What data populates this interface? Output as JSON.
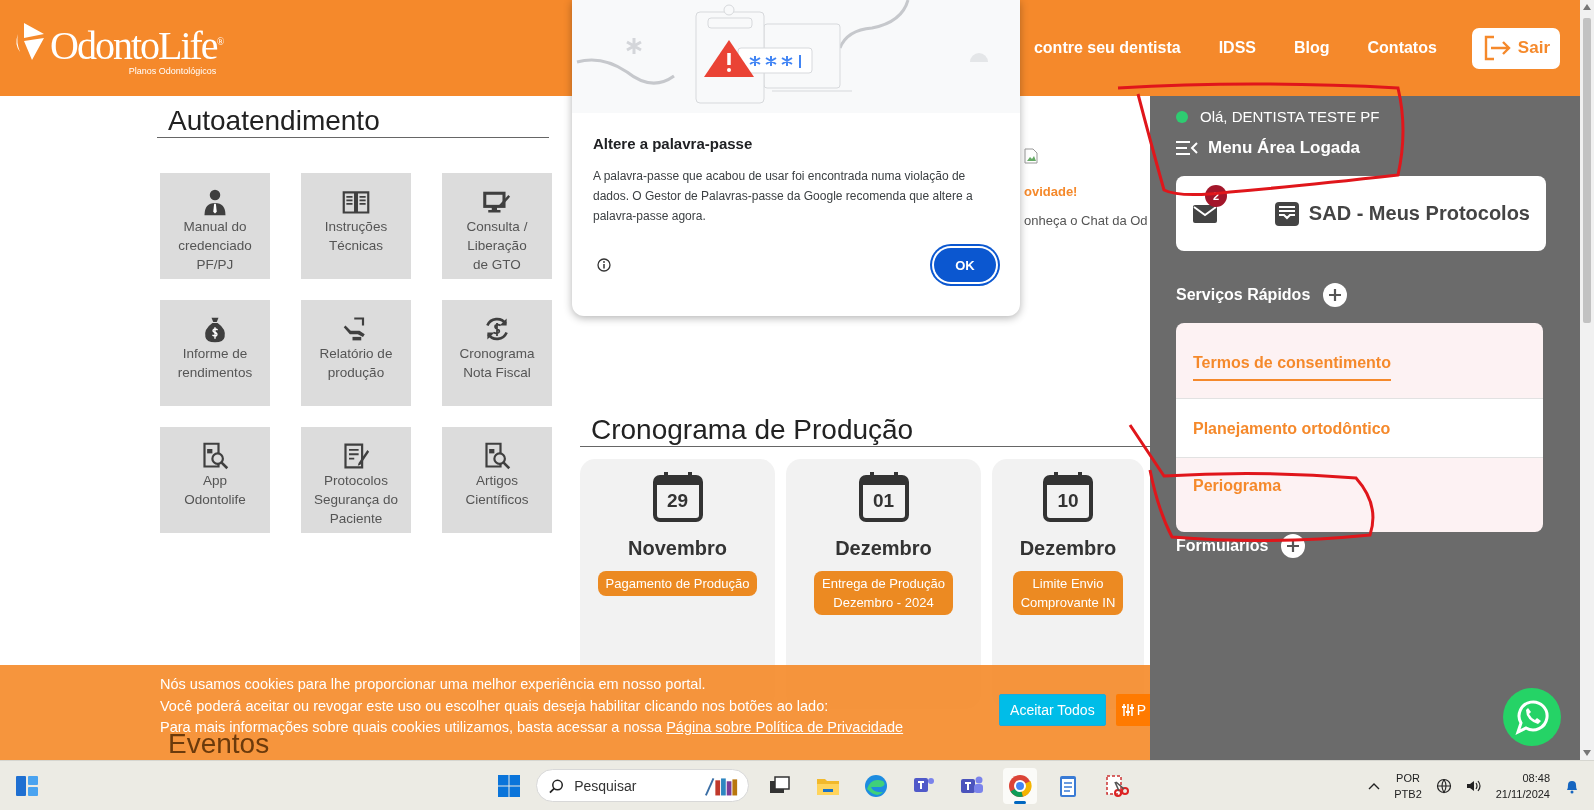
{
  "header": {
    "logo": {
      "name": "OdontoLife",
      "mark": "®",
      "tagline": "Planos Odontológicos"
    },
    "nav": [
      {
        "label": "contre seu dentista"
      },
      {
        "label": "IDSS"
      },
      {
        "label": "Blog"
      },
      {
        "label": "Contatos"
      }
    ],
    "logout_button": "Sair"
  },
  "self_service": {
    "title": "Autoatendimento",
    "tiles": [
      {
        "label": "Manual do\ncredenciado\nPF/PJ"
      },
      {
        "label": "Instruções\nTécnicas"
      },
      {
        "label": "Consulta /\nLiberação\nde GTO"
      },
      {
        "label": "Informe de\nrendimentos"
      },
      {
        "label": "Relatório de\nprodução"
      },
      {
        "label": "Cronograma\nNota Fiscal"
      },
      {
        "label": "App\nOdontolife"
      },
      {
        "label": "Protocolos\nSegurança do\nPaciente"
      },
      {
        "label": "Artigos\nCientíficos"
      }
    ]
  },
  "news": {
    "title": "ovidade!",
    "text": "onheça o Chat da Od"
  },
  "schedule": {
    "title": "Cronograma de Produção",
    "events": [
      {
        "day": "29",
        "month": "Novembro",
        "label": "Pagamento de Produção"
      },
      {
        "day": "01",
        "month": "Dezembro",
        "label": "Entrega de Produção\nDezembro - 2024"
      },
      {
        "day": "10",
        "month": "Dezembro",
        "label": "Limite Envio\nComprovante IN"
      }
    ]
  },
  "events_title": "Eventos",
  "dialog": {
    "title": "Altere a palavra-passe",
    "body": "A palavra-passe que acabou de usar foi encontrada numa violação de dados. O Gestor de Palavras-passe da Google recomenda que altere a palavra-passe agora.",
    "ok_button": "OK"
  },
  "panel": {
    "online": true,
    "greeting": "Olá, DENTISTA TESTE PF",
    "menu_title": "Menu Área Logada",
    "messages_badge": "2",
    "protocols_link": "SAD - Meus Protocolos",
    "quick_services": {
      "title": "Serviços Rápidos",
      "items": [
        {
          "label": "Termos de consentimento",
          "selected": true
        },
        {
          "label": "Planejamento ortodôntico",
          "selected": false
        },
        {
          "label": "Periograma",
          "selected": false
        }
      ]
    },
    "forms_title": "Formulários"
  },
  "cookie_bar": {
    "lines": [
      "Nós usamos cookies para lhe proporcionar uma melhor experiência em nosso portal.",
      "Você poderá aceitar ou revogar este uso ou escolher quais deseja habilitar clicando nos botões ao lado:",
      "Para mais informações sobre quais cookies utilizamos, basta acessar a nossa"
    ],
    "policy_link": "Página sobre Política de Privacidade",
    "accept_button": "Aceitar Todos",
    "customize_button": "P"
  },
  "taskbar": {
    "search_placeholder": "Pesquisar",
    "apps": [
      {
        "selected": false
      },
      {
        "selected": false
      },
      {
        "selected": false
      },
      {
        "selected": false
      },
      {
        "selected": false
      },
      {
        "selected": true
      },
      {
        "selected": false
      },
      {
        "selected": false
      }
    ],
    "language": "POR",
    "layout": "PTB2",
    "time": "08:48",
    "date": "21/11/2024"
  }
}
